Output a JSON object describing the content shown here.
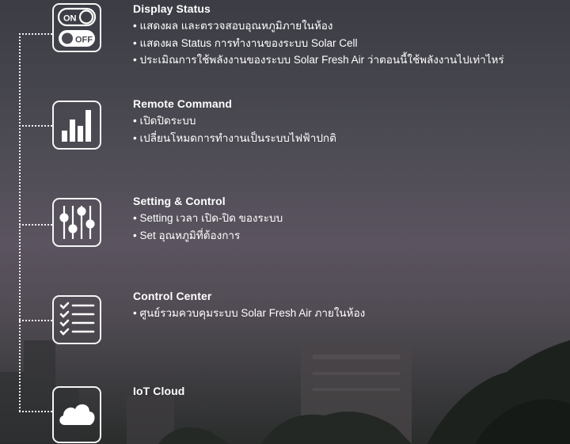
{
  "features": [
    {
      "title": "Display Status",
      "icon": "on-off-toggle-icon",
      "items": [
        "แสดงผล และตรวจสอบอุณหภูมิภายในห้อง",
        "แสดงผล Status การทำงานของระบบ Solar Cell",
        "ประเมิณการใช้พลังงานของระบบ Solar Fresh Air ว่าตอนนี้ใช้พลังงานไปเท่าไหร่"
      ],
      "toggle_on": "ON",
      "toggle_off": "OFF"
    },
    {
      "title": "Remote Command",
      "icon": "bar-chart-icon",
      "items": [
        "เปิดปิดระบบ",
        "เปลี่ยนโหมดการทำงานเป็นระบบไฟฟ้าปกติ"
      ]
    },
    {
      "title": "Setting & Control",
      "icon": "sliders-icon",
      "items": [
        "Setting เวลา เปิด-ปิด ของระบบ",
        "Set อุณหภูมิที่ต้องการ"
      ]
    },
    {
      "title": "Control Center",
      "icon": "checklist-icon",
      "items": [
        "ศูนย์รวมควบคุมระบบ Solar Fresh Air ภายในห้อง"
      ]
    },
    {
      "title": "IoT Cloud",
      "icon": "cloud-icon",
      "items": []
    }
  ]
}
